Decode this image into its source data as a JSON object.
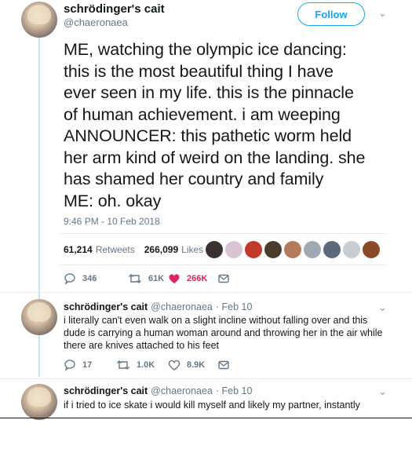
{
  "tweet": {
    "display_name": "schrödinger's cait",
    "handle": "@chaeronaea",
    "follow_label": "Follow",
    "text": "ME, watching the olympic ice dancing:\nthis is the most beautiful thing I have\never seen in my life. this is the pinnacle\nof human achievement. i am weeping\nANNOUNCER: this pathetic worm held\nher arm kind of weird on the landing. she\nhas shamed her country and family\nME: oh. okay",
    "timestamp": "9:46 PM - 10 Feb 2018",
    "retweets_count": "61,214",
    "retweets_label": "Retweets",
    "likes_count": "266,099",
    "likes_label": "Likes",
    "actions": {
      "reply": "346",
      "retweet": "61K",
      "like": "266K"
    },
    "like_color": "#e0245e"
  },
  "replies": [
    {
      "display_name": "schrödinger's cait",
      "handle": "@chaeronaea",
      "date": "· Feb 10",
      "text": "i literally can't even walk on a slight incline without falling over and this dude is carrying a human woman around and throwing her in the air while there are knives attached to his feet",
      "reply": "17",
      "retweet": "1.0K",
      "like": "8.9K"
    },
    {
      "display_name": "schrödinger's cait",
      "handle": "@chaeronaea",
      "date": "· Feb 10",
      "text": "if i tried to ice skate i would kill myself and likely my partner, instantly"
    }
  ],
  "colors": {
    "accent": "#1da1f2",
    "muted": "#657786",
    "thread_line": "#cbe4f5"
  }
}
